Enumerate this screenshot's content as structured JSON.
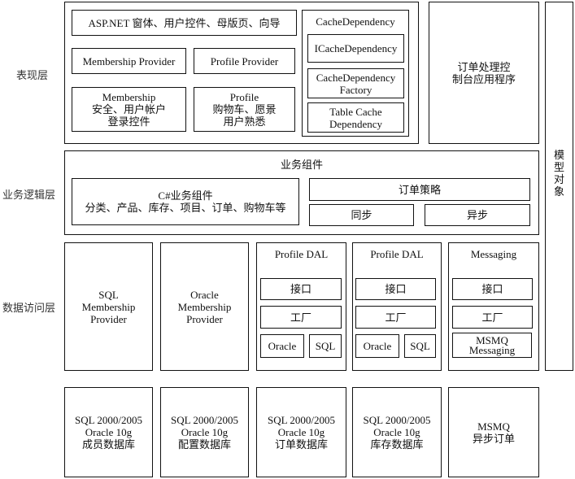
{
  "layers": {
    "presentation": "表现层",
    "business": "业务逻辑层",
    "data_access": "数据访问层"
  },
  "presentation": {
    "aspnet": "ASP.NET 窗体、用户控件、母版页、向导",
    "membership_provider": "Membership Provider",
    "profile_provider": "Profile Provider",
    "membership": [
      "Membership",
      "安全、用户帐户",
      "登录控件"
    ],
    "profile": [
      "Profile",
      "购物车、愿景",
      "用户熟悉"
    ],
    "cache": {
      "title": "CacheDependency",
      "items": [
        [
          "ICacheDependency"
        ],
        [
          "CacheDependency",
          "Factory"
        ],
        [
          "Table Cache",
          "Dependency"
        ]
      ]
    }
  },
  "order_console": [
    "订单处理控",
    "制台应用程序"
  ],
  "model": [
    "模",
    "型",
    "对",
    "象"
  ],
  "business": {
    "title": "业务组件",
    "csharp": [
      "C#业务组件",
      "分类、产品、库存、项目、订单、购物车等"
    ],
    "order_strategy": "订单策略",
    "sync": "同步",
    "async": "异步"
  },
  "data_access": {
    "sql_membership": [
      "SQL",
      "Membership",
      "Provider"
    ],
    "oracle_membership": [
      "Oracle",
      "Membership",
      "Provider"
    ],
    "dal": [
      {
        "title": "Profile DAL",
        "interface": "接口",
        "factory": "工厂",
        "left": "Oracle",
        "right": "SQL"
      },
      {
        "title": "Profile DAL",
        "interface": "接口",
        "factory": "工厂",
        "left": "Oracle",
        "right": "SQL"
      }
    ],
    "messaging": {
      "title": "Messaging",
      "interface": "接口",
      "factory": "工厂",
      "impl": [
        "MSMQ",
        "Messaging"
      ]
    }
  },
  "databases": [
    [
      "SQL 2000/2005",
      "Oracle 10g",
      "成员数据库"
    ],
    [
      "SQL 2000/2005",
      "Oracle 10g",
      "配置数据库"
    ],
    [
      "SQL 2000/2005",
      "Oracle 10g",
      "订单数据库"
    ],
    [
      "SQL 2000/2005",
      "Oracle 10g",
      "库存数据库"
    ],
    [
      "MSMQ",
      "异步订单"
    ]
  ]
}
